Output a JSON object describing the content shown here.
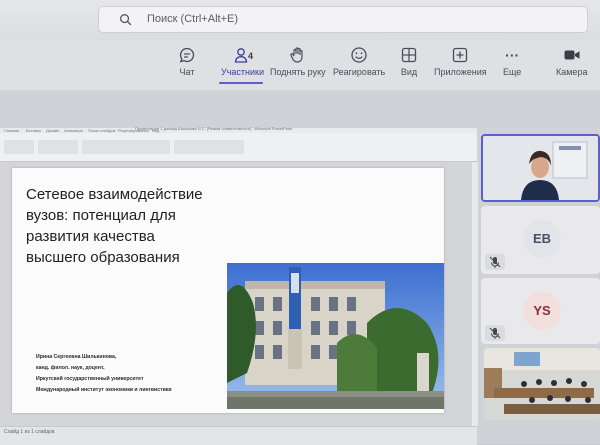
{
  "search": {
    "placeholder": "Поиск (Ctrl+Alt+E)"
  },
  "toolbar": {
    "items": [
      {
        "label": "Чат",
        "icon": "chat-icon"
      },
      {
        "label": "Участники",
        "icon": "people-icon",
        "count": "4"
      },
      {
        "label": "Поднять руку",
        "icon": "raise-hand-icon"
      },
      {
        "label": "Реагировать",
        "icon": "smiley-icon"
      },
      {
        "label": "Вид",
        "icon": "grid-view-icon"
      },
      {
        "label": "Приложения",
        "icon": "apps-plus-icon"
      },
      {
        "label": "Еще",
        "icon": "more-icon",
        "glyph": "···"
      },
      {
        "label": "Камера",
        "icon": "camera-icon"
      }
    ],
    "accent": "#5b5fc7"
  },
  "ppt": {
    "window_title": "Презентация 1 доклад Шилькова И.С. [Режим совместимости] - Microsoft PowerPoint",
    "ribbon_tabs": [
      "Главная",
      "Вставка",
      "Дизайн",
      "Анимация",
      "Показ слайдов",
      "Рецензирование",
      "Вид"
    ],
    "status": "Слайд 1 из 1 слайдов"
  },
  "slide": {
    "title_lines": [
      "Сетевое взаимодействие",
      "вузов: потенциал для",
      "развития качества",
      "высшего образования"
    ],
    "author_lines": [
      "Ирина Сергеевна Шилькинова,",
      "канд. филол. наук, доцент,",
      "Иркутский государственный университет",
      "Международный институт экономики и лингвистики"
    ]
  },
  "participants": [
    {
      "initials": "EB",
      "color": "#4a4f66"
    },
    {
      "initials": "YS",
      "color": "#8a2f3c"
    }
  ]
}
